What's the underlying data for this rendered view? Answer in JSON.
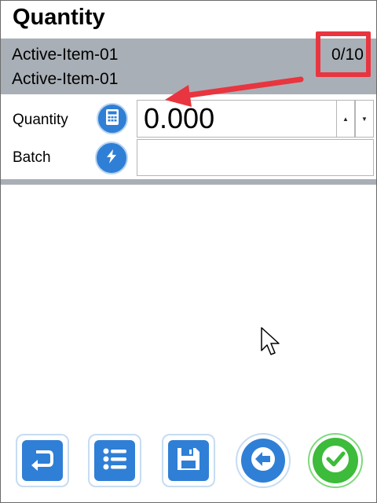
{
  "header": {
    "title": "Quantity"
  },
  "item": {
    "line1": "Active-Item-01",
    "line2": "Active-Item-01",
    "counter": "0/10"
  },
  "form": {
    "quantity_label": "Quantity",
    "quantity_value": "0.000",
    "batch_label": "Batch",
    "batch_value": ""
  },
  "icons": {
    "quantity_button": "calculator-icon",
    "batch_button": "lightning-icon",
    "spin_up": "triangle-up-icon",
    "spin_down": "triangle-down-icon"
  },
  "toolbar": {
    "buttons": [
      "undo-icon",
      "list-icon",
      "save-icon",
      "back-arrow-icon",
      "checkmark-icon"
    ]
  },
  "colors": {
    "accent_blue": "#2f7fd6",
    "band_gray": "#a9afb6",
    "highlight_red": "#e8353f",
    "confirm_green": "#3dbb3b"
  }
}
